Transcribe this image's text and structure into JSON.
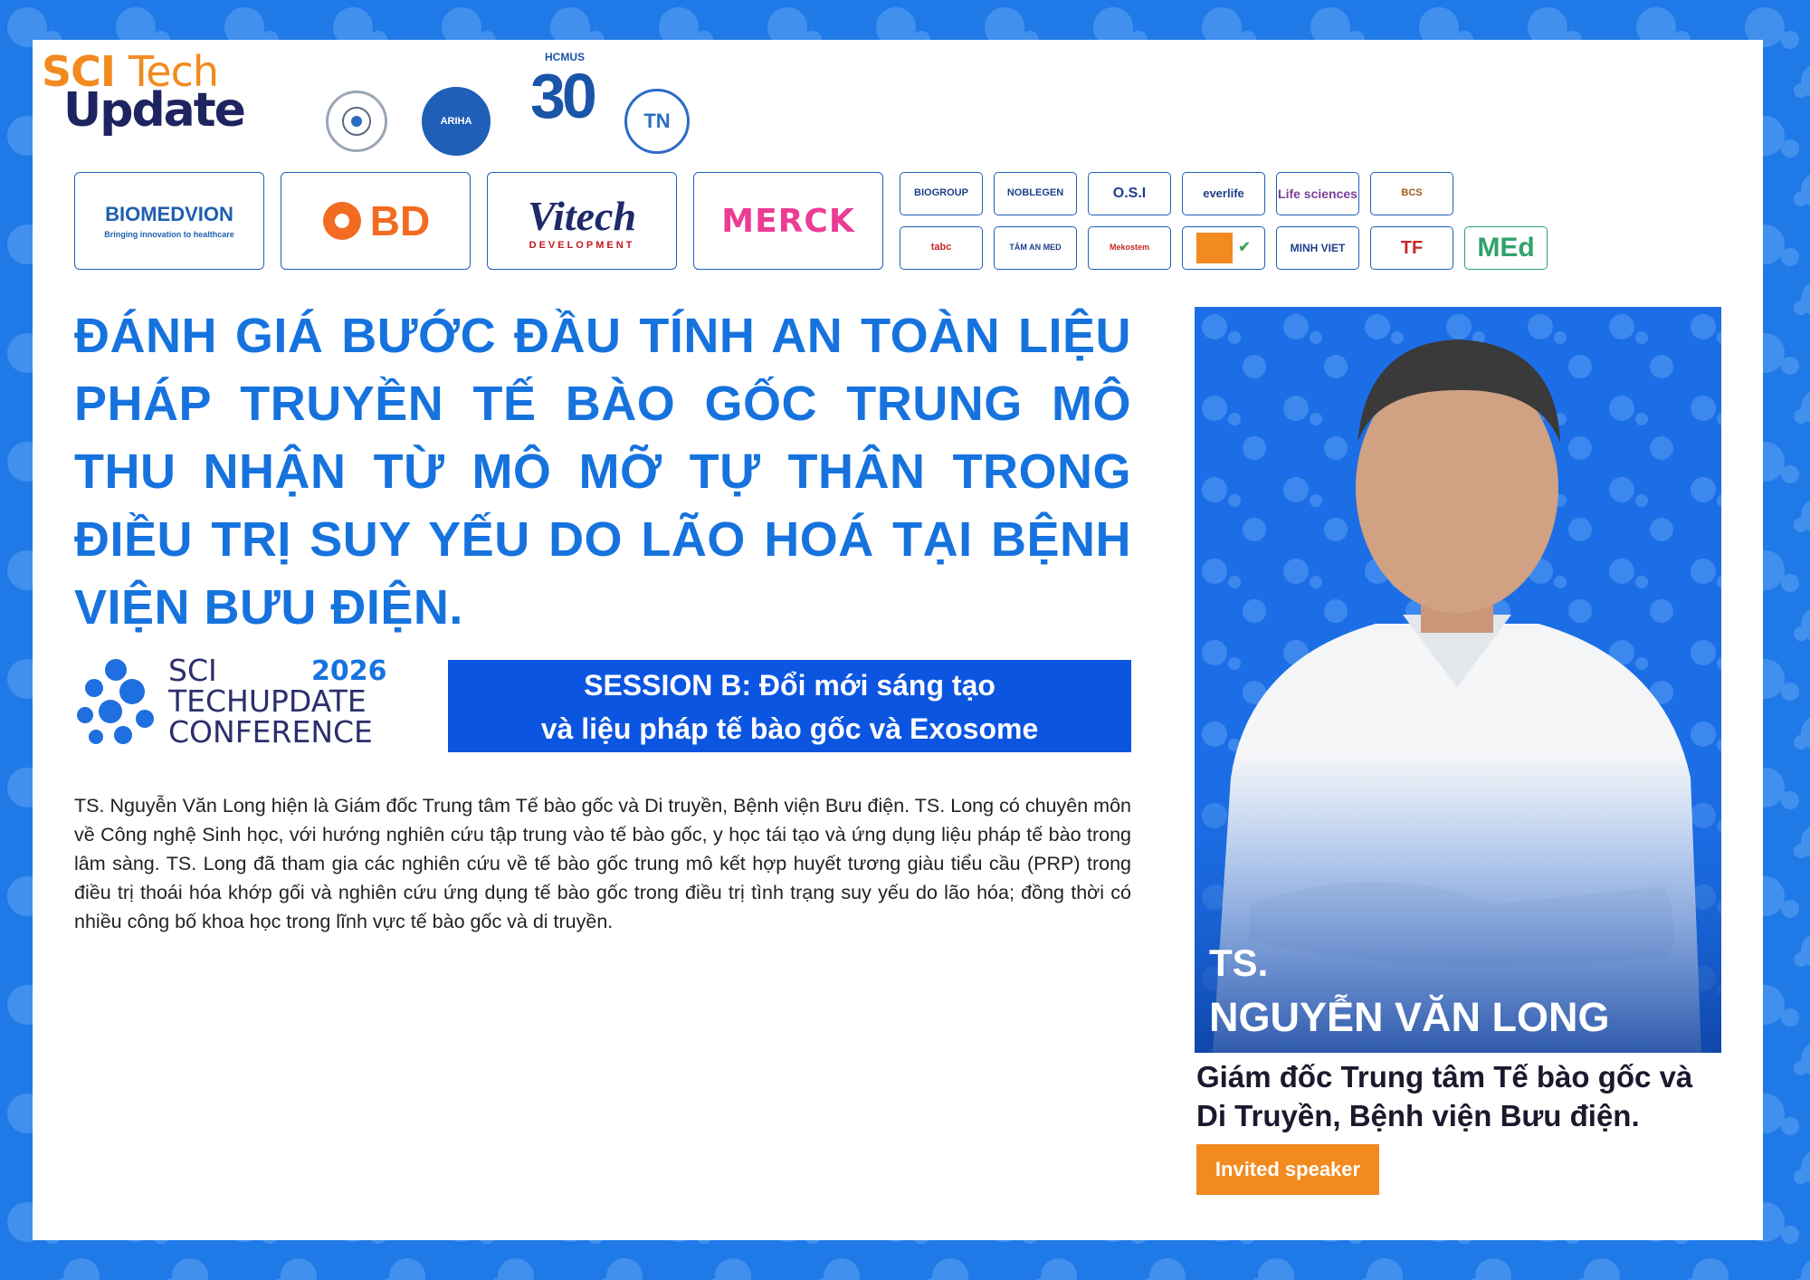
{
  "header": {
    "brand": {
      "sci": "SCI",
      "tech": "Tech",
      "update": "Update"
    },
    "hcmus": {
      "label": "HCMUS",
      "number": "30"
    },
    "ariha_label": "ARIHA",
    "tn_label": "TN"
  },
  "sponsors_large": [
    {
      "label": "BIOMEDVION",
      "tagline": "Bringing innovation to healthcare"
    },
    {
      "label": "BD"
    },
    {
      "label": "Vitech",
      "sub": "DEVELOPMENT"
    },
    {
      "label": "MERCK"
    }
  ],
  "sponsors_small_row1": [
    "BIOGROUP",
    "NOBLEGEN",
    "O.S.I",
    "everlife",
    "Life sciences",
    "BCS"
  ],
  "sponsors_small_row2": [
    "tabc",
    "TÂM AN MED",
    "Mekostem",
    "",
    "MINH VIET",
    "TF",
    "MEd"
  ],
  "title": "ĐÁNH GIÁ BƯỚC ĐẦU TÍNH AN TOÀN LIỆU PHÁP TRUYỀN TẾ BÀO GỐC TRUNG MÔ THU NHẬN TỪ MÔ MỠ TỰ THÂN TRONG ĐIỀU TRỊ SUY YẾU DO LÃO HOÁ TẠI BỆNH VIỆN BƯU ĐIỆN.",
  "conference": {
    "line1": "SCI",
    "line2": "TECHUPDATE",
    "line3": "CONFERENCE",
    "year": "2026"
  },
  "session": {
    "line1": "SESSION B: Đổi mới sáng tạo",
    "line2": "và liệu pháp tế bào gốc và Exosome"
  },
  "bio": "TS. Nguyễn Văn Long hiện là Giám đốc Trung tâm Tế bào gốc và Di truyền, Bệnh viện Bưu điện. TS. Long có chuyên môn về Công nghệ Sinh học, với hướng nghiên cứu tập trung vào tế bào gốc, y học tái tạo và ứng dụng liệu pháp tế bào trong lâm sàng. TS. Long đã tham gia các nghiên cứu về tế bào gốc trung mô kết hợp huyết tương giàu tiểu cầu (PRP) trong điều trị thoái hóa khớp gối và nghiên cứu ứng dụng tế bào gốc trong điều trị tình trạng suy yếu do lão hóa; đồng thời có nhiều công bố khoa học trong lĩnh vực tế bào gốc và di truyền.",
  "speaker": {
    "title": "TS.",
    "name": "NGUYỄN VĂN LONG",
    "role_line1": "Giám đốc Trung tâm Tế bào gốc và",
    "role_line2": "Di Truyền, Bệnh viện Bưu điện.",
    "badge": "Invited speaker"
  },
  "colors": {
    "frame": "#1f7ae8",
    "title": "#1673de",
    "session_bg": "#0b55e0",
    "badge": "#f28a1f"
  }
}
